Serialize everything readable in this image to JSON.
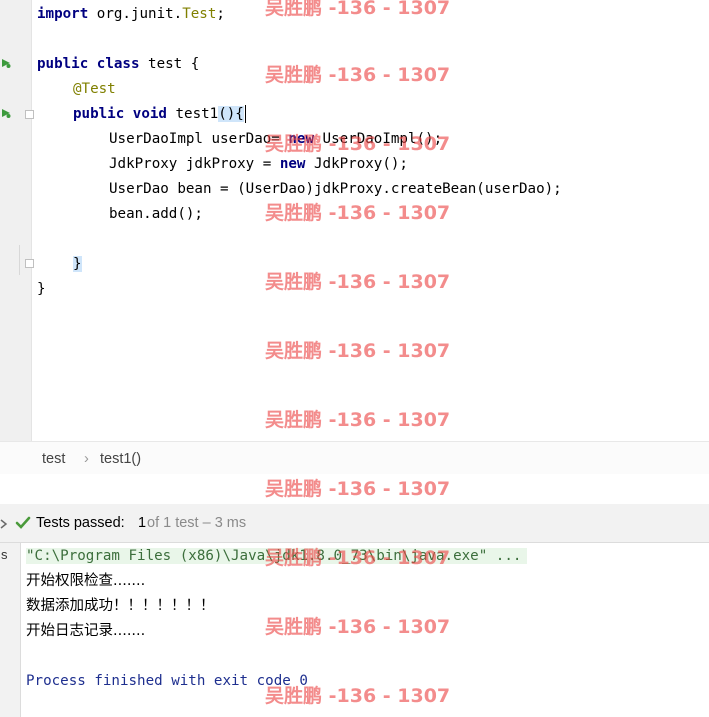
{
  "editor": {
    "lines": {
      "import_kw": "import",
      "import_path": " org.junit.",
      "import_class": "Test",
      "import_end": ";",
      "class_kw": "public class",
      "class_name": " test {",
      "annotation": "@Test",
      "method_kw": "public void",
      "method_name": " test1",
      "method_parens": "(){",
      "l5a": "UserDaoImpl userDao= ",
      "l5kw": "new",
      "l5b": " UserDaoImpl();",
      "l6a": "JdkProxy jdkProxy = ",
      "l6kw": "new",
      "l6b": " JdkProxy();",
      "l7": "UserDao bean = (UserDao)jdkProxy.createBean(userDao);",
      "l8": "bean.add();",
      "close_method": "}",
      "close_class": "}"
    }
  },
  "breadcrumb": {
    "items": [
      "test",
      "test1()"
    ],
    "separator": "›"
  },
  "run": {
    "status_label": "Tests passed:",
    "passed": "1",
    "rest": " of 1 test – 3 ms",
    "side_label": "s"
  },
  "console": {
    "cmd": "\"C:\\Program Files (x86)\\Java\\jdk1.8.0_73\\bin\\java.exe\" ...",
    "out1": "开始权限检查.......",
    "out2": "数据添加成功！！！！！！！",
    "out3": "开始日志记录.......",
    "finish": "Process finished with exit code 0"
  },
  "watermark": "吴胜鹏 -136 - 1307",
  "colors": {
    "keyword": "#000080",
    "annotation": "#808000",
    "pass_check": "#4a9a3b",
    "run_icon": "#3d9a3d",
    "finish_text": "#1e2f8f"
  }
}
